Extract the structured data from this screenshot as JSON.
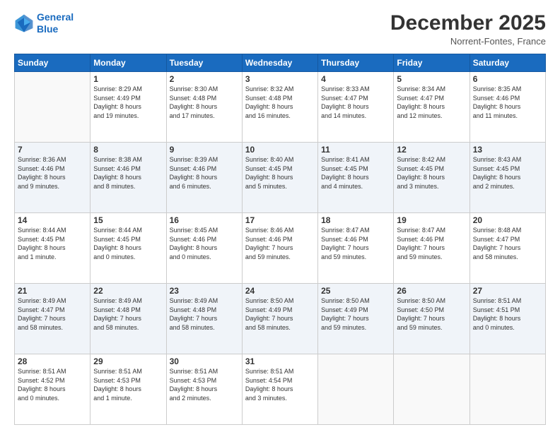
{
  "header": {
    "logo_line1": "General",
    "logo_line2": "Blue",
    "title": "December 2025",
    "location": "Norrent-Fontes, France"
  },
  "days_of_week": [
    "Sunday",
    "Monday",
    "Tuesday",
    "Wednesday",
    "Thursday",
    "Friday",
    "Saturday"
  ],
  "weeks": [
    [
      {
        "day": "",
        "info": ""
      },
      {
        "day": "1",
        "info": "Sunrise: 8:29 AM\nSunset: 4:49 PM\nDaylight: 8 hours\nand 19 minutes."
      },
      {
        "day": "2",
        "info": "Sunrise: 8:30 AM\nSunset: 4:48 PM\nDaylight: 8 hours\nand 17 minutes."
      },
      {
        "day": "3",
        "info": "Sunrise: 8:32 AM\nSunset: 4:48 PM\nDaylight: 8 hours\nand 16 minutes."
      },
      {
        "day": "4",
        "info": "Sunrise: 8:33 AM\nSunset: 4:47 PM\nDaylight: 8 hours\nand 14 minutes."
      },
      {
        "day": "5",
        "info": "Sunrise: 8:34 AM\nSunset: 4:47 PM\nDaylight: 8 hours\nand 12 minutes."
      },
      {
        "day": "6",
        "info": "Sunrise: 8:35 AM\nSunset: 4:46 PM\nDaylight: 8 hours\nand 11 minutes."
      }
    ],
    [
      {
        "day": "7",
        "info": "Sunrise: 8:36 AM\nSunset: 4:46 PM\nDaylight: 8 hours\nand 9 minutes."
      },
      {
        "day": "8",
        "info": "Sunrise: 8:38 AM\nSunset: 4:46 PM\nDaylight: 8 hours\nand 8 minutes."
      },
      {
        "day": "9",
        "info": "Sunrise: 8:39 AM\nSunset: 4:46 PM\nDaylight: 8 hours\nand 6 minutes."
      },
      {
        "day": "10",
        "info": "Sunrise: 8:40 AM\nSunset: 4:45 PM\nDaylight: 8 hours\nand 5 minutes."
      },
      {
        "day": "11",
        "info": "Sunrise: 8:41 AM\nSunset: 4:45 PM\nDaylight: 8 hours\nand 4 minutes."
      },
      {
        "day": "12",
        "info": "Sunrise: 8:42 AM\nSunset: 4:45 PM\nDaylight: 8 hours\nand 3 minutes."
      },
      {
        "day": "13",
        "info": "Sunrise: 8:43 AM\nSunset: 4:45 PM\nDaylight: 8 hours\nand 2 minutes."
      }
    ],
    [
      {
        "day": "14",
        "info": "Sunrise: 8:44 AM\nSunset: 4:45 PM\nDaylight: 8 hours\nand 1 minute."
      },
      {
        "day": "15",
        "info": "Sunrise: 8:44 AM\nSunset: 4:45 PM\nDaylight: 8 hours\nand 0 minutes."
      },
      {
        "day": "16",
        "info": "Sunrise: 8:45 AM\nSunset: 4:46 PM\nDaylight: 8 hours\nand 0 minutes."
      },
      {
        "day": "17",
        "info": "Sunrise: 8:46 AM\nSunset: 4:46 PM\nDaylight: 7 hours\nand 59 minutes."
      },
      {
        "day": "18",
        "info": "Sunrise: 8:47 AM\nSunset: 4:46 PM\nDaylight: 7 hours\nand 59 minutes."
      },
      {
        "day": "19",
        "info": "Sunrise: 8:47 AM\nSunset: 4:46 PM\nDaylight: 7 hours\nand 59 minutes."
      },
      {
        "day": "20",
        "info": "Sunrise: 8:48 AM\nSunset: 4:47 PM\nDaylight: 7 hours\nand 58 minutes."
      }
    ],
    [
      {
        "day": "21",
        "info": "Sunrise: 8:49 AM\nSunset: 4:47 PM\nDaylight: 7 hours\nand 58 minutes."
      },
      {
        "day": "22",
        "info": "Sunrise: 8:49 AM\nSunset: 4:48 PM\nDaylight: 7 hours\nand 58 minutes."
      },
      {
        "day": "23",
        "info": "Sunrise: 8:49 AM\nSunset: 4:48 PM\nDaylight: 7 hours\nand 58 minutes."
      },
      {
        "day": "24",
        "info": "Sunrise: 8:50 AM\nSunset: 4:49 PM\nDaylight: 7 hours\nand 58 minutes."
      },
      {
        "day": "25",
        "info": "Sunrise: 8:50 AM\nSunset: 4:49 PM\nDaylight: 7 hours\nand 59 minutes."
      },
      {
        "day": "26",
        "info": "Sunrise: 8:50 AM\nSunset: 4:50 PM\nDaylight: 7 hours\nand 59 minutes."
      },
      {
        "day": "27",
        "info": "Sunrise: 8:51 AM\nSunset: 4:51 PM\nDaylight: 8 hours\nand 0 minutes."
      }
    ],
    [
      {
        "day": "28",
        "info": "Sunrise: 8:51 AM\nSunset: 4:52 PM\nDaylight: 8 hours\nand 0 minutes."
      },
      {
        "day": "29",
        "info": "Sunrise: 8:51 AM\nSunset: 4:53 PM\nDaylight: 8 hours\nand 1 minute."
      },
      {
        "day": "30",
        "info": "Sunrise: 8:51 AM\nSunset: 4:53 PM\nDaylight: 8 hours\nand 2 minutes."
      },
      {
        "day": "31",
        "info": "Sunrise: 8:51 AM\nSunset: 4:54 PM\nDaylight: 8 hours\nand 3 minutes."
      },
      {
        "day": "",
        "info": ""
      },
      {
        "day": "",
        "info": ""
      },
      {
        "day": "",
        "info": ""
      }
    ]
  ]
}
